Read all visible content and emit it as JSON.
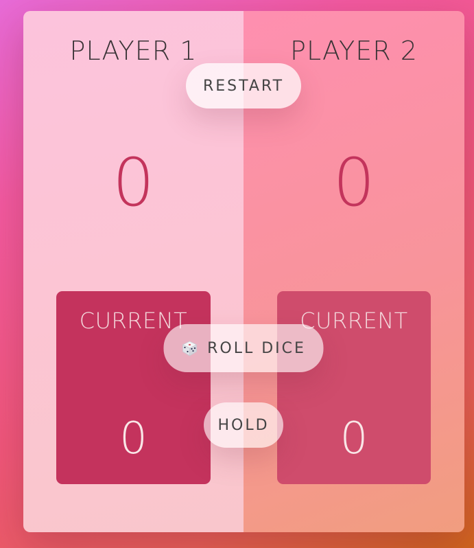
{
  "players": [
    {
      "name": "PLAYER 1",
      "score": "0",
      "current_label": "CURRENT",
      "current_score": "0"
    },
    {
      "name": "PLAYER 2",
      "score": "0",
      "current_label": "CURRENT",
      "current_score": "0"
    }
  ],
  "controls": {
    "restart_label": "RESTART",
    "roll_label": "ROLL DICE",
    "roll_icon": "dice-icon",
    "hold_label": "HOLD"
  },
  "colors": {
    "score": "#c3345c",
    "current_box_p1": "#c4335d",
    "current_box_p2": "#cf4c6c"
  }
}
